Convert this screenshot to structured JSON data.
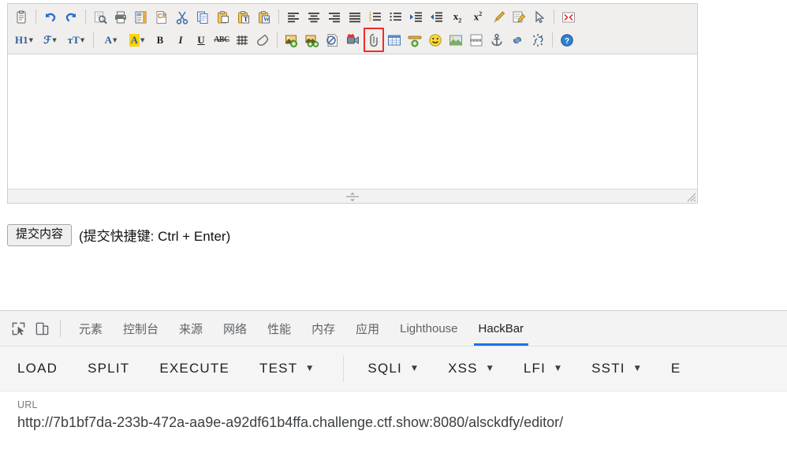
{
  "editor": {
    "toolbar_row1": [
      {
        "name": "paste-from-clipboard-icon",
        "kind": "clipboard",
        "label": ""
      },
      {
        "name": "separator",
        "kind": "sep",
        "label": ""
      },
      {
        "name": "undo-icon",
        "kind": "undo",
        "label": ""
      },
      {
        "name": "redo-icon",
        "kind": "redo",
        "label": ""
      },
      {
        "name": "separator",
        "kind": "sep",
        "label": ""
      },
      {
        "name": "print-preview-icon",
        "kind": "preview",
        "label": ""
      },
      {
        "name": "print-icon",
        "kind": "print",
        "label": ""
      },
      {
        "name": "template-icon",
        "kind": "template",
        "label": ""
      },
      {
        "name": "code-csharp-icon",
        "kind": "csharp",
        "label": "C#"
      },
      {
        "name": "cut-icon",
        "kind": "cut",
        "label": ""
      },
      {
        "name": "copy-icon",
        "kind": "copy",
        "label": ""
      },
      {
        "name": "paste-icon",
        "kind": "paste",
        "label": ""
      },
      {
        "name": "paste-as-text-icon",
        "kind": "paste-text",
        "label": "T"
      },
      {
        "name": "paste-from-word-icon",
        "kind": "paste-word",
        "label": "W"
      },
      {
        "name": "separator",
        "kind": "sep",
        "label": ""
      },
      {
        "name": "align-left-icon",
        "kind": "align-left",
        "label": ""
      },
      {
        "name": "align-center-icon",
        "kind": "align-center",
        "label": ""
      },
      {
        "name": "align-right-icon",
        "kind": "align-right",
        "label": ""
      },
      {
        "name": "align-justify-icon",
        "kind": "align-justify",
        "label": ""
      },
      {
        "name": "ordered-list-icon",
        "kind": "ol",
        "label": ""
      },
      {
        "name": "unordered-list-icon",
        "kind": "ul",
        "label": ""
      },
      {
        "name": "indent-increase-icon",
        "kind": "indent",
        "label": ""
      },
      {
        "name": "indent-decrease-icon",
        "kind": "outdent",
        "label": ""
      },
      {
        "name": "subscript-icon",
        "kind": "sub",
        "label": "x₂"
      },
      {
        "name": "superscript-icon",
        "kind": "sup",
        "label": "x²"
      },
      {
        "name": "format-brush-icon",
        "kind": "brush",
        "label": ""
      },
      {
        "name": "edit-source-icon",
        "kind": "editsrc",
        "label": ""
      },
      {
        "name": "select-cursor-icon",
        "kind": "cursor",
        "label": ""
      },
      {
        "name": "separator",
        "kind": "sep",
        "label": ""
      },
      {
        "name": "fullscreen-icon",
        "kind": "fullscreen",
        "label": ""
      }
    ],
    "toolbar_row2": [
      {
        "name": "heading-select",
        "kind": "text-drop",
        "label": "H1"
      },
      {
        "name": "font-family-select",
        "kind": "text-drop",
        "label": "ℱ"
      },
      {
        "name": "font-size-select",
        "kind": "text-drop",
        "label": "ᴛT"
      },
      {
        "name": "separator",
        "kind": "sep",
        "label": ""
      },
      {
        "name": "text-color-select",
        "kind": "text-drop",
        "label": "A"
      },
      {
        "name": "background-color-select",
        "kind": "hl-drop",
        "label": "A"
      },
      {
        "name": "bold-button",
        "kind": "bold",
        "label": "B"
      },
      {
        "name": "italic-button",
        "kind": "italic",
        "label": "I"
      },
      {
        "name": "underline-button",
        "kind": "underline",
        "label": "U"
      },
      {
        "name": "strikethrough-button",
        "kind": "strike",
        "label": "ABC"
      },
      {
        "name": "remove-format-grid-icon",
        "kind": "grid",
        "label": ""
      },
      {
        "name": "eraser-icon",
        "kind": "eraser",
        "label": ""
      },
      {
        "name": "separator",
        "kind": "sep",
        "label": ""
      },
      {
        "name": "insert-image-icon",
        "kind": "image-add",
        "label": ""
      },
      {
        "name": "insert-multi-image-icon",
        "kind": "images-add",
        "label": ""
      },
      {
        "name": "insert-flash-icon",
        "kind": "flash",
        "label": ""
      },
      {
        "name": "insert-video-icon",
        "kind": "video",
        "label": ""
      },
      {
        "name": "insert-attachment-icon",
        "kind": "attachment",
        "label": "",
        "highlighted": true
      },
      {
        "name": "insert-table-icon",
        "kind": "table",
        "label": ""
      },
      {
        "name": "insert-horizontal-rule-icon",
        "kind": "hr",
        "label": ""
      },
      {
        "name": "insert-emoticon-icon",
        "kind": "smiley",
        "label": ""
      },
      {
        "name": "insert-map-icon",
        "kind": "map",
        "label": ""
      },
      {
        "name": "page-break-icon",
        "kind": "pagebreak",
        "label": ""
      },
      {
        "name": "anchor-icon",
        "kind": "anchor",
        "label": ""
      },
      {
        "name": "insert-link-icon",
        "kind": "link",
        "label": ""
      },
      {
        "name": "unlink-icon",
        "kind": "unlink",
        "label": ""
      },
      {
        "name": "separator",
        "kind": "sep",
        "label": ""
      },
      {
        "name": "help-icon",
        "kind": "help",
        "label": ""
      }
    ],
    "content": ""
  },
  "submit": {
    "button_label": "提交内容",
    "hint": "(提交快捷键: Ctrl + Enter)"
  },
  "devtools": {
    "tabs": [
      {
        "label": "元素",
        "active": false
      },
      {
        "label": "控制台",
        "active": false
      },
      {
        "label": "来源",
        "active": false
      },
      {
        "label": "网络",
        "active": false
      },
      {
        "label": "性能",
        "active": false
      },
      {
        "label": "内存",
        "active": false
      },
      {
        "label": "应用",
        "active": false
      },
      {
        "label": "Lighthouse",
        "active": false
      },
      {
        "label": "HackBar",
        "active": true
      }
    ],
    "accent_color": "#1a73e8"
  },
  "hackbar": {
    "actions": [
      {
        "label": "LOAD",
        "has_dropdown": false
      },
      {
        "label": "SPLIT",
        "has_dropdown": false
      },
      {
        "label": "EXECUTE",
        "has_dropdown": false
      },
      {
        "label": "TEST",
        "has_dropdown": true
      }
    ],
    "payloads": [
      {
        "label": "SQLI",
        "has_dropdown": true
      },
      {
        "label": "XSS",
        "has_dropdown": true
      },
      {
        "label": "LFI",
        "has_dropdown": true
      },
      {
        "label": "SSTI",
        "has_dropdown": true
      },
      {
        "label": "E",
        "has_dropdown": false
      }
    ],
    "url_label": "URL",
    "url_value": "http://7b1bf7da-233b-472a-aa9e-a92df61b4ffa.challenge.ctf.show:8080/alsckdfy/editor/"
  }
}
